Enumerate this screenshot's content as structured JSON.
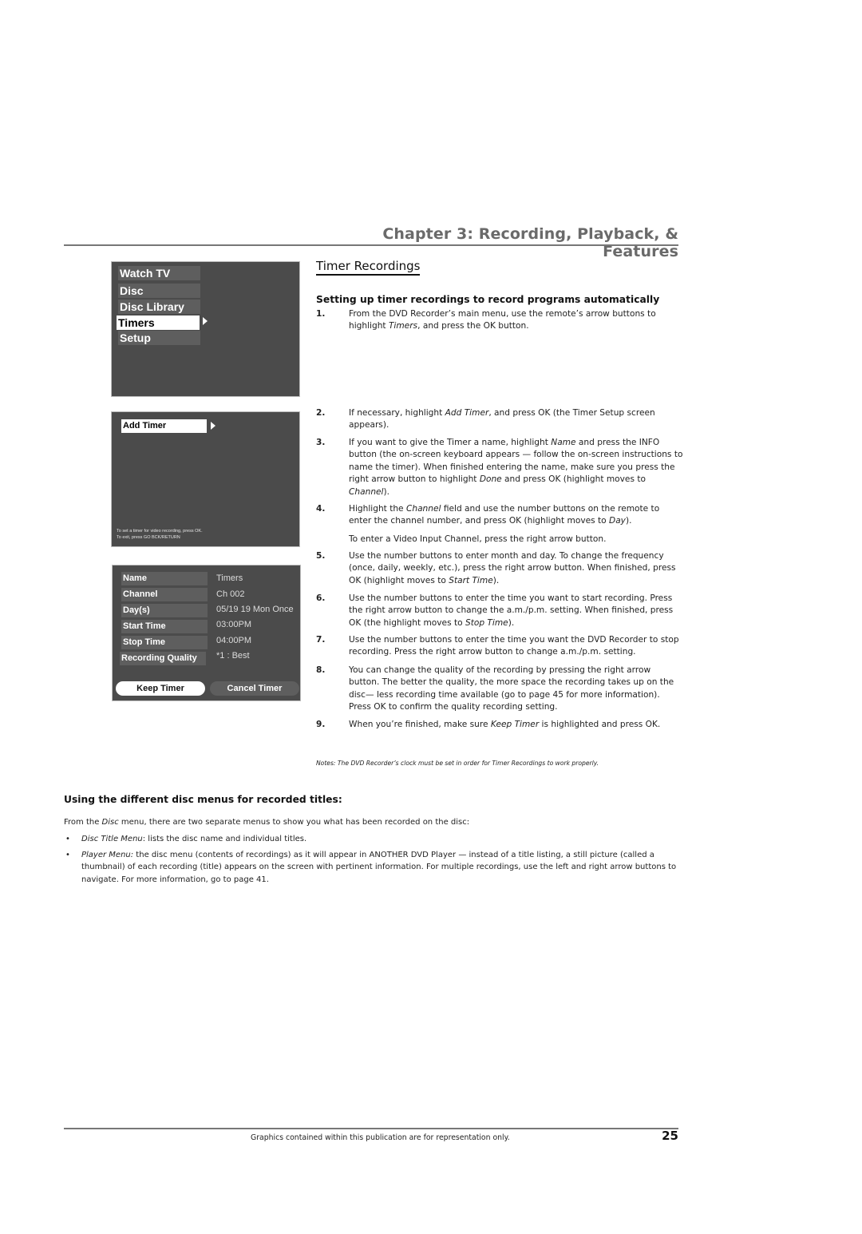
{
  "header": {
    "chapter_title": "Chapter 3: Recording, Playback, & Features"
  },
  "section": {
    "title": "Timer Recordings",
    "subtitle": "Setting up timer recordings to record programs automatically"
  },
  "screens": {
    "main_menu": {
      "items": [
        {
          "label": "Watch TV",
          "selected": false
        },
        {
          "label": "Disc",
          "selected": false
        },
        {
          "label": "Disc Library",
          "selected": false
        },
        {
          "label": "Timers",
          "selected": true
        },
        {
          "label": "Setup",
          "selected": false
        }
      ],
      "colors": {
        "background": "#4b4b4b",
        "item": "#5e5e5e",
        "highlight": "#ffffff"
      }
    },
    "timers_menu": {
      "add_timer_label": "Add Timer",
      "hint_line1": "To set a timer for video recording, press OK.",
      "hint_line2": "To exit, press GO BCK/RETURN"
    },
    "timer_setup": {
      "fields": [
        {
          "label": "Name",
          "value": "Timers"
        },
        {
          "label": "Channel",
          "value": "Ch 002"
        },
        {
          "label": "Day(s)",
          "value": "05/19 19 Mon Once"
        },
        {
          "label": "Start Time",
          "value": "03:00PM"
        },
        {
          "label": "Stop Time",
          "value": "04:00PM"
        },
        {
          "label": "Recording Quality",
          "value": "*1 : Best"
        }
      ],
      "keep_button": "Keep Timer",
      "cancel_button": "Cancel Timer"
    }
  },
  "steps": [
    {
      "num": "1.",
      "parts": [
        "From the DVD Recorder’s main menu, use the remote’s arrow buttons to highlight ",
        {
          "i": "Timers"
        },
        ", and press the OK button."
      ]
    },
    {
      "num": "2.",
      "parts": [
        "If necessary, highlight ",
        {
          "i": "Add Timer"
        },
        ", and press OK (the Timer Setup screen appears)."
      ]
    },
    {
      "num": "3.",
      "parts": [
        "If you want to give the Timer a name, highlight ",
        {
          "i": "Name"
        },
        " and press the INFO button (the on-screen keyboard appears — follow the on-screen instructions to name the timer). When finished entering the name, make sure you press the right arrow button to highlight ",
        {
          "i": "Done"
        },
        " and press OK (highlight moves to ",
        {
          "i": "Channel"
        },
        ")."
      ]
    },
    {
      "num": "4.",
      "parts": [
        "Highlight the ",
        {
          "i": "Channel"
        },
        " field and use the number buttons on the remote to enter the channel number, and press OK (highlight moves to ",
        {
          "i": "Day"
        },
        ")."
      ]
    },
    {
      "num": "",
      "parts": [
        "To enter a Video Input Channel, press the right arrow button."
      ]
    },
    {
      "num": "5.",
      "parts": [
        "Use the number buttons to enter month and day. To change the frequency (once, daily, weekly, etc.), press the right arrow button. When finished, press OK (highlight moves to ",
        {
          "i": "Start Time"
        },
        ")."
      ]
    },
    {
      "num": "6.",
      "parts": [
        "Use the number buttons to enter the time you want to start recording. Press the right arrow button to change the a.m./p.m. setting. When finished, press OK (the highlight moves to ",
        {
          "i": "Stop Time"
        },
        ")."
      ]
    },
    {
      "num": "7.",
      "parts": [
        "Use the number buttons to enter the time you want the DVD Recorder to stop recording. Press the right arrow button to change a.m./p.m. setting."
      ]
    },
    {
      "num": "8.",
      "parts": [
        "You can change the quality of the recording by pressing the right arrow button. The better the quality, the more space the recording takes up on the disc— less recording time available (go to page 45 for more information). Press OK to confirm the quality recording setting."
      ]
    },
    {
      "num": "9.",
      "parts": [
        "When you’re finished, make sure ",
        {
          "i": "Keep Timer"
        },
        " is highlighted and press OK."
      ]
    }
  ],
  "note": "Notes: The DVD Recorder’s clock must be set in order for Timer Recordings to work properly.",
  "disc_menus": {
    "title": "Using the different disc menus for recorded titles:",
    "intro_parts": [
      "From the ",
      {
        "i": "Disc"
      },
      " menu, there are two separate menus to show you what has been recorded on the disc:"
    ],
    "bullets": [
      {
        "parts": [
          {
            "i": "Disc Title Menu"
          },
          ": lists the disc name and individual titles."
        ]
      },
      {
        "parts": [
          {
            "i": "Player Menu:"
          },
          " the disc menu (contents of recordings) as it will appear in  ANOTHER DVD Player — instead of a title listing, a still picture (called a thumbnail) of each recording (title) appears on the screen with pertinent information. For multiple recordings, use the left and right arrow buttons to navigate. For more information, go to page 41."
        ]
      }
    ],
    "bullet_char": "•"
  },
  "footer": {
    "text": "Graphics contained within this publication are for representation only.",
    "page_number": "25"
  }
}
